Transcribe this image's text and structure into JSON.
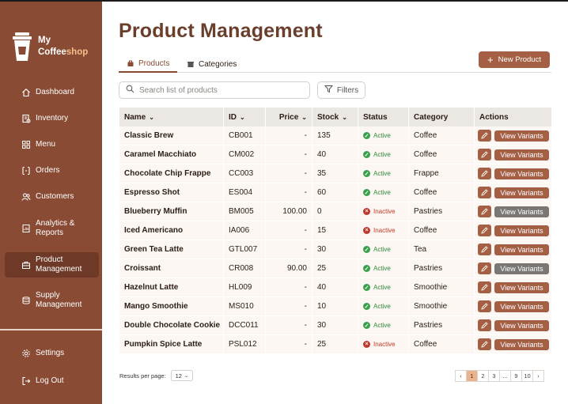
{
  "brand": {
    "line1": "My",
    "line2a": "Coffee",
    "line2b": "shop"
  },
  "nav": [
    {
      "label": "Dashboard",
      "icon": "home-icon"
    },
    {
      "label": "Inventory",
      "icon": "inventory-icon"
    },
    {
      "label": "Menu",
      "icon": "menu-grid-icon"
    },
    {
      "label": "Orders",
      "icon": "orders-icon"
    },
    {
      "label": "Customers",
      "icon": "customers-icon"
    },
    {
      "label": "Analytics & Reports",
      "icon": "analytics-icon"
    },
    {
      "label": "Product Management",
      "icon": "product-icon"
    },
    {
      "label": "Supply Management",
      "icon": "supply-icon"
    }
  ],
  "bottom_nav": [
    {
      "label": "Settings",
      "icon": "gear-icon"
    },
    {
      "label": "Log Out",
      "icon": "logout-icon"
    }
  ],
  "page": {
    "title": "Product Management"
  },
  "tabs": [
    {
      "label": "Products",
      "icon": "bag-icon"
    },
    {
      "label": "Categories",
      "icon": "box-icon"
    }
  ],
  "toolbar": {
    "new_label": "New Product",
    "search_placeholder": "Search list of products",
    "filters_label": "Filters"
  },
  "table": {
    "headers": {
      "name": "Name",
      "id": "ID",
      "price": "Price",
      "stock": "Stock",
      "status": "Status",
      "category": "Category",
      "actions": "Actions"
    },
    "variant_label": "View Variants",
    "rows": [
      {
        "name": "Classic Brew",
        "id": "CB001",
        "price": "-",
        "stock": "135",
        "status": "Active",
        "category": "Coffee",
        "variants_disabled": false
      },
      {
        "name": "Caramel Macchiato",
        "id": "CM002",
        "price": "-",
        "stock": "40",
        "status": "Active",
        "category": "Coffee",
        "variants_disabled": false
      },
      {
        "name": "Chocolate Chip Frappe",
        "id": "CC003",
        "price": "-",
        "stock": "35",
        "status": "Active",
        "category": "Frappe",
        "variants_disabled": false
      },
      {
        "name": "Espresso Shot",
        "id": "ES004",
        "price": "-",
        "stock": "60",
        "status": "Active",
        "category": "Coffee",
        "variants_disabled": false
      },
      {
        "name": "Blueberry Muffin",
        "id": "BM005",
        "price": "100.00",
        "stock": "0",
        "status": "Inactive",
        "category": "Pastries",
        "variants_disabled": true
      },
      {
        "name": "Iced Americano",
        "id": "IA006",
        "price": "-",
        "stock": "15",
        "status": "Inactive",
        "category": "Coffee",
        "variants_disabled": false
      },
      {
        "name": "Green Tea Latte",
        "id": "GTL007",
        "price": "-",
        "stock": "30",
        "status": "Active",
        "category": "Tea",
        "variants_disabled": false
      },
      {
        "name": "Croissant",
        "id": "CR008",
        "price": "90.00",
        "stock": "25",
        "status": "Active",
        "category": "Pastries",
        "variants_disabled": true
      },
      {
        "name": "Hazelnut Latte",
        "id": "HL009",
        "price": "-",
        "stock": "40",
        "status": "Active",
        "category": "Smoothie",
        "variants_disabled": false
      },
      {
        "name": "Mango Smoothie",
        "id": "MS010",
        "price": "-",
        "stock": "10",
        "status": "Active",
        "category": "Smoothie",
        "variants_disabled": false
      },
      {
        "name": "Double Chocolate Cookie",
        "id": "DCC011",
        "price": "-",
        "stock": "30",
        "status": "Active",
        "category": "Pastries",
        "variants_disabled": false
      },
      {
        "name": "Pumpkin Spice Latte",
        "id": "PSL012",
        "price": "-",
        "stock": "25",
        "status": "Inactive",
        "category": "Coffee",
        "variants_disabled": false
      }
    ]
  },
  "footer": {
    "rpp_label": "Results per page:",
    "rpp_value": "12",
    "pages": [
      "‹",
      "1",
      "2",
      "3",
      "...",
      "9",
      "10",
      "›"
    ],
    "current_page": "1"
  },
  "colors": {
    "primary": "#8a4b34",
    "accent": "#a55f45",
    "active": "#3aa14a",
    "inactive": "#c0392b",
    "disabled": "#7a7775"
  }
}
